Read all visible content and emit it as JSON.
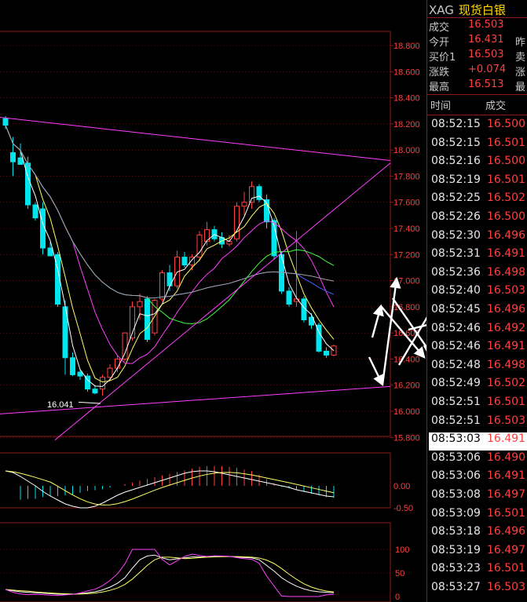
{
  "header": {
    "symbol": "XAG",
    "name": "现货白银"
  },
  "quote": [
    {
      "label": "成交",
      "value": "16.503",
      "extra": ""
    },
    {
      "label": "今开",
      "value": "16.431",
      "extra": "昨"
    },
    {
      "label": "买价1",
      "value": "16.503",
      "extra": "卖"
    },
    {
      "label": "涨跌",
      "value": "+0.074",
      "extra": "涨"
    },
    {
      "label": "最高",
      "value": "16.513",
      "extra": "最"
    }
  ],
  "ticks_header": {
    "time": "时间",
    "price": "成交"
  },
  "ticks": [
    {
      "time": "08:52:15",
      "price": "16.500",
      "color": "#ff4040"
    },
    {
      "time": "08:52:15",
      "price": "16.501",
      "color": "#ff4040"
    },
    {
      "time": "08:52:16",
      "price": "16.500",
      "color": "#ff4040"
    },
    {
      "time": "08:52:19",
      "price": "16.501",
      "color": "#ff4040"
    },
    {
      "time": "08:52:25",
      "price": "16.502",
      "color": "#ff4040"
    },
    {
      "time": "08:52:26",
      "price": "16.500",
      "color": "#ff4040"
    },
    {
      "time": "08:52:30",
      "price": "16.496",
      "color": "#ff4040"
    },
    {
      "time": "08:52:31",
      "price": "16.491",
      "color": "#ff4040"
    },
    {
      "time": "08:52:36",
      "price": "16.498",
      "color": "#ff4040"
    },
    {
      "time": "08:52:40",
      "price": "16.503",
      "color": "#ff4040"
    },
    {
      "time": "08:52:45",
      "price": "16.496",
      "color": "#ff4040"
    },
    {
      "time": "08:52:46",
      "price": "16.492",
      "color": "#ff4040"
    },
    {
      "time": "08:52:46",
      "price": "16.491",
      "color": "#ff4040"
    },
    {
      "time": "08:52:48",
      "price": "16.498",
      "color": "#ff4040"
    },
    {
      "time": "08:52:49",
      "price": "16.502",
      "color": "#ff4040"
    },
    {
      "time": "08:52:51",
      "price": "16.501",
      "color": "#ff4040"
    },
    {
      "time": "08:52:51",
      "price": "16.503",
      "color": "#ff4040"
    },
    {
      "time": "08:53:03",
      "price": "16.491",
      "color": "#ff4040",
      "highlight": true
    },
    {
      "time": "08:53:06",
      "price": "16.490",
      "color": "#ff4040"
    },
    {
      "time": "08:53:06",
      "price": "16.491",
      "color": "#ff4040"
    },
    {
      "time": "08:53:08",
      "price": "16.497",
      "color": "#ff4040"
    },
    {
      "time": "08:53:09",
      "price": "16.501",
      "color": "#ff4040"
    },
    {
      "time": "08:53:18",
      "price": "16.496",
      "color": "#ff4040"
    },
    {
      "time": "08:53:19",
      "price": "16.497",
      "color": "#ff4040"
    },
    {
      "time": "08:53:23",
      "price": "16.501",
      "color": "#ff4040"
    },
    {
      "time": "08:53:27",
      "price": "16.503",
      "color": "#ff4040"
    }
  ],
  "colors": {
    "up": "#ff4040",
    "down": "#00e5ee",
    "grid": "#8b1a1a",
    "axis_text": "#ff4040"
  },
  "chart_data": [
    {
      "type": "candlestick",
      "panel": "price",
      "y_ticks": [
        "18.800",
        "18.600",
        "18.400",
        "18.200",
        "18.000",
        "17.800",
        "17.600",
        "17.400",
        "17.200",
        "17.000",
        "16.800",
        "16.600",
        "16.400",
        "16.200",
        "16.000",
        "15.800"
      ],
      "ylim": [
        15.8,
        18.8
      ],
      "annotation": {
        "text": "16.041",
        "value": 16.041
      },
      "candles": [
        {
          "o": 18.24,
          "h": 18.26,
          "l": 18.16,
          "c": 18.19
        },
        {
          "o": 17.98,
          "h": 18.1,
          "l": 17.8,
          "c": 17.91
        },
        {
          "o": 17.94,
          "h": 18.05,
          "l": 17.89,
          "c": 17.89
        },
        {
          "o": 17.9,
          "h": 17.95,
          "l": 17.55,
          "c": 17.58
        },
        {
          "o": 17.58,
          "h": 17.6,
          "l": 17.46,
          "c": 17.48
        },
        {
          "o": 17.55,
          "h": 17.6,
          "l": 17.2,
          "c": 17.25
        },
        {
          "o": 17.25,
          "h": 17.3,
          "l": 17.19,
          "c": 17.19
        },
        {
          "o": 17.2,
          "h": 17.22,
          "l": 16.8,
          "c": 16.82
        },
        {
          "o": 16.8,
          "h": 16.85,
          "l": 16.28,
          "c": 16.41
        },
        {
          "o": 16.41,
          "h": 16.45,
          "l": 16.27,
          "c": 16.28
        },
        {
          "o": 16.3,
          "h": 16.32,
          "l": 16.24,
          "c": 16.27
        },
        {
          "o": 16.27,
          "h": 16.29,
          "l": 16.15,
          "c": 16.17
        },
        {
          "o": 16.17,
          "h": 16.2,
          "l": 16.13,
          "c": 16.14
        },
        {
          "o": 16.17,
          "h": 16.28,
          "l": 16.12,
          "c": 16.26
        },
        {
          "o": 16.26,
          "h": 16.36,
          "l": 16.23,
          "c": 16.33
        },
        {
          "o": 16.33,
          "h": 16.43,
          "l": 16.3,
          "c": 16.4
        },
        {
          "o": 16.4,
          "h": 16.6,
          "l": 16.38,
          "c": 16.6
        },
        {
          "o": 16.56,
          "h": 16.84,
          "l": 16.54,
          "c": 16.8
        },
        {
          "o": 16.8,
          "h": 16.9,
          "l": 16.7,
          "c": 16.84
        },
        {
          "o": 16.86,
          "h": 16.88,
          "l": 16.53,
          "c": 16.55
        },
        {
          "o": 16.6,
          "h": 16.86,
          "l": 16.58,
          "c": 16.85
        },
        {
          "o": 16.86,
          "h": 17.08,
          "l": 16.84,
          "c": 17.06
        },
        {
          "o": 17.06,
          "h": 17.12,
          "l": 16.92,
          "c": 16.96
        },
        {
          "o": 16.96,
          "h": 17.23,
          "l": 16.94,
          "c": 17.18
        },
        {
          "o": 17.18,
          "h": 17.22,
          "l": 17.1,
          "c": 17.12
        },
        {
          "o": 17.12,
          "h": 17.2,
          "l": 17.08,
          "c": 17.18
        },
        {
          "o": 17.18,
          "h": 17.38,
          "l": 17.15,
          "c": 17.35
        },
        {
          "o": 17.3,
          "h": 17.45,
          "l": 17.27,
          "c": 17.39
        },
        {
          "o": 17.39,
          "h": 17.42,
          "l": 17.3,
          "c": 17.32
        },
        {
          "o": 17.33,
          "h": 17.37,
          "l": 17.25,
          "c": 17.28
        },
        {
          "o": 17.28,
          "h": 17.35,
          "l": 17.26,
          "c": 17.3
        },
        {
          "o": 17.32,
          "h": 17.6,
          "l": 17.3,
          "c": 17.57
        },
        {
          "o": 17.57,
          "h": 17.68,
          "l": 17.5,
          "c": 17.6
        },
        {
          "o": 17.6,
          "h": 17.76,
          "l": 17.55,
          "c": 17.72
        },
        {
          "o": 17.72,
          "h": 17.74,
          "l": 17.6,
          "c": 17.62
        },
        {
          "o": 17.62,
          "h": 17.66,
          "l": 17.4,
          "c": 17.45
        },
        {
          "o": 17.46,
          "h": 17.48,
          "l": 17.16,
          "c": 17.19
        },
        {
          "o": 17.2,
          "h": 17.22,
          "l": 16.9,
          "c": 16.92
        },
        {
          "o": 16.92,
          "h": 16.95,
          "l": 16.8,
          "c": 16.82
        },
        {
          "o": 16.84,
          "h": 17.38,
          "l": 16.8,
          "c": 16.86
        },
        {
          "o": 16.86,
          "h": 16.88,
          "l": 16.68,
          "c": 16.7
        },
        {
          "o": 16.72,
          "h": 16.75,
          "l": 16.63,
          "c": 16.66
        },
        {
          "o": 16.66,
          "h": 16.68,
          "l": 16.45,
          "c": 16.46
        },
        {
          "o": 16.46,
          "h": 16.49,
          "l": 16.41,
          "c": 16.43
        },
        {
          "o": 16.43,
          "h": 16.51,
          "l": 16.42,
          "c": 16.5
        }
      ]
    },
    {
      "type": "bar",
      "panel": "macd",
      "y_ticks": [
        "0.00",
        "-0.50"
      ],
      "ylim": [
        -0.5,
        0.35
      ],
      "values": [
        0,
        0,
        -0.16,
        -0.15,
        -0.15,
        -0.13,
        -0.12,
        -0.12,
        -0.11,
        -0.1,
        -0.08,
        -0.06,
        -0.05,
        -0.04,
        -0.02,
        0,
        0.02,
        0.04,
        0.06,
        0.08,
        0.1,
        0.12,
        0.14,
        0.16,
        0.18,
        0.2,
        0.22,
        0.23,
        0.23,
        0.23,
        0.22,
        0.21,
        0.19,
        0.17,
        0.13,
        0.08,
        0.03,
        -0.01,
        -0.03,
        -0.05,
        -0.07,
        -0.09,
        -0.11,
        -0.13,
        -0.14
      ]
    },
    {
      "type": "line",
      "panel": "kdj",
      "y_ticks": [
        "100",
        "50",
        "0"
      ],
      "ylim": [
        0,
        100
      ]
    }
  ]
}
